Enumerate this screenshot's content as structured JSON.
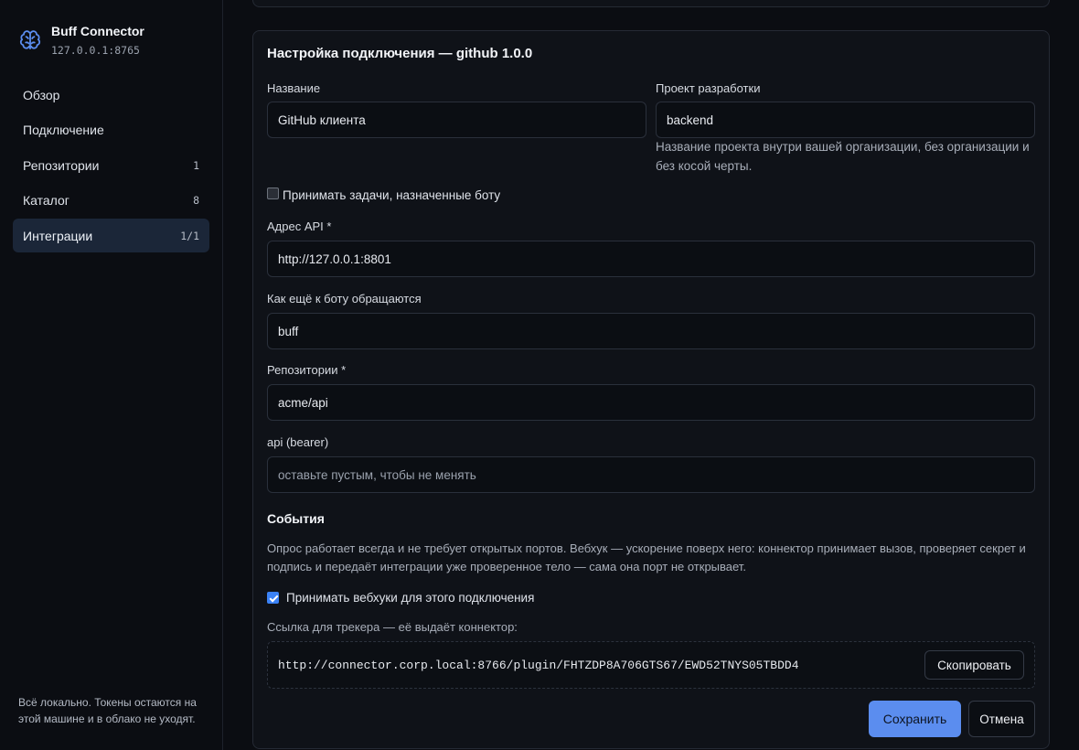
{
  "brand": {
    "title": "Buff Connector",
    "address": "127.0.0.1:8765"
  },
  "nav": [
    {
      "label": "Обзор",
      "count": ""
    },
    {
      "label": "Подключение",
      "count": ""
    },
    {
      "label": "Репозитории",
      "count": "1"
    },
    {
      "label": "Каталог",
      "count": "8"
    },
    {
      "label": "Интеграции",
      "count": "1/1",
      "active": true
    }
  ],
  "sidebar_footer": "Всё локально. Токены остаются на этой машине и в облако не уходят.",
  "form": {
    "title": "Настройка подключения — github 1.0.0",
    "name_label": "Название",
    "name_value": "GitHub клиента",
    "project_label": "Проект разработки",
    "project_value": "backend",
    "project_hint": "Название проекта внутри вашей организации, без организации и без косой черты.",
    "accept_tasks_label": "Принимать задачи, назначенные боту",
    "accept_tasks_checked": false,
    "api_label": "Адрес API *",
    "api_value": "http://127.0.0.1:8801",
    "aliases_label": "Как ещё к боту обращаются",
    "aliases_value": "buff",
    "repos_label": "Репозитории *",
    "repos_value": "acme/api",
    "token_label": "api (bearer)",
    "token_placeholder": "оставьте пустым, чтобы не менять",
    "events_title": "События",
    "events_desc": "Опрос работает всегда и не требует открытых портов. Вебхук — ускорение поверх него: коннектор принимает вызов, проверяет секрет и подпись и передаёт интеграции уже проверенное тело — сама она порт не открывает.",
    "webhook_label": "Принимать вебхуки для этого подключения",
    "webhook_checked": true,
    "tracker_link_label": "Ссылка для трекера — её выдаёт коннектор:",
    "webhook_url": "http://connector.corp.local:8766/plugin/FHTZDP8A706GTS67/EWD52TNYS05TBDD4",
    "copy_button": "Скопировать",
    "save_button": "Сохранить",
    "cancel_button": "Отмена"
  },
  "colors": {
    "accent": "#5b8def",
    "active_nav": "#1b2638",
    "background": "#0b0d12",
    "card": "#0f1218"
  }
}
